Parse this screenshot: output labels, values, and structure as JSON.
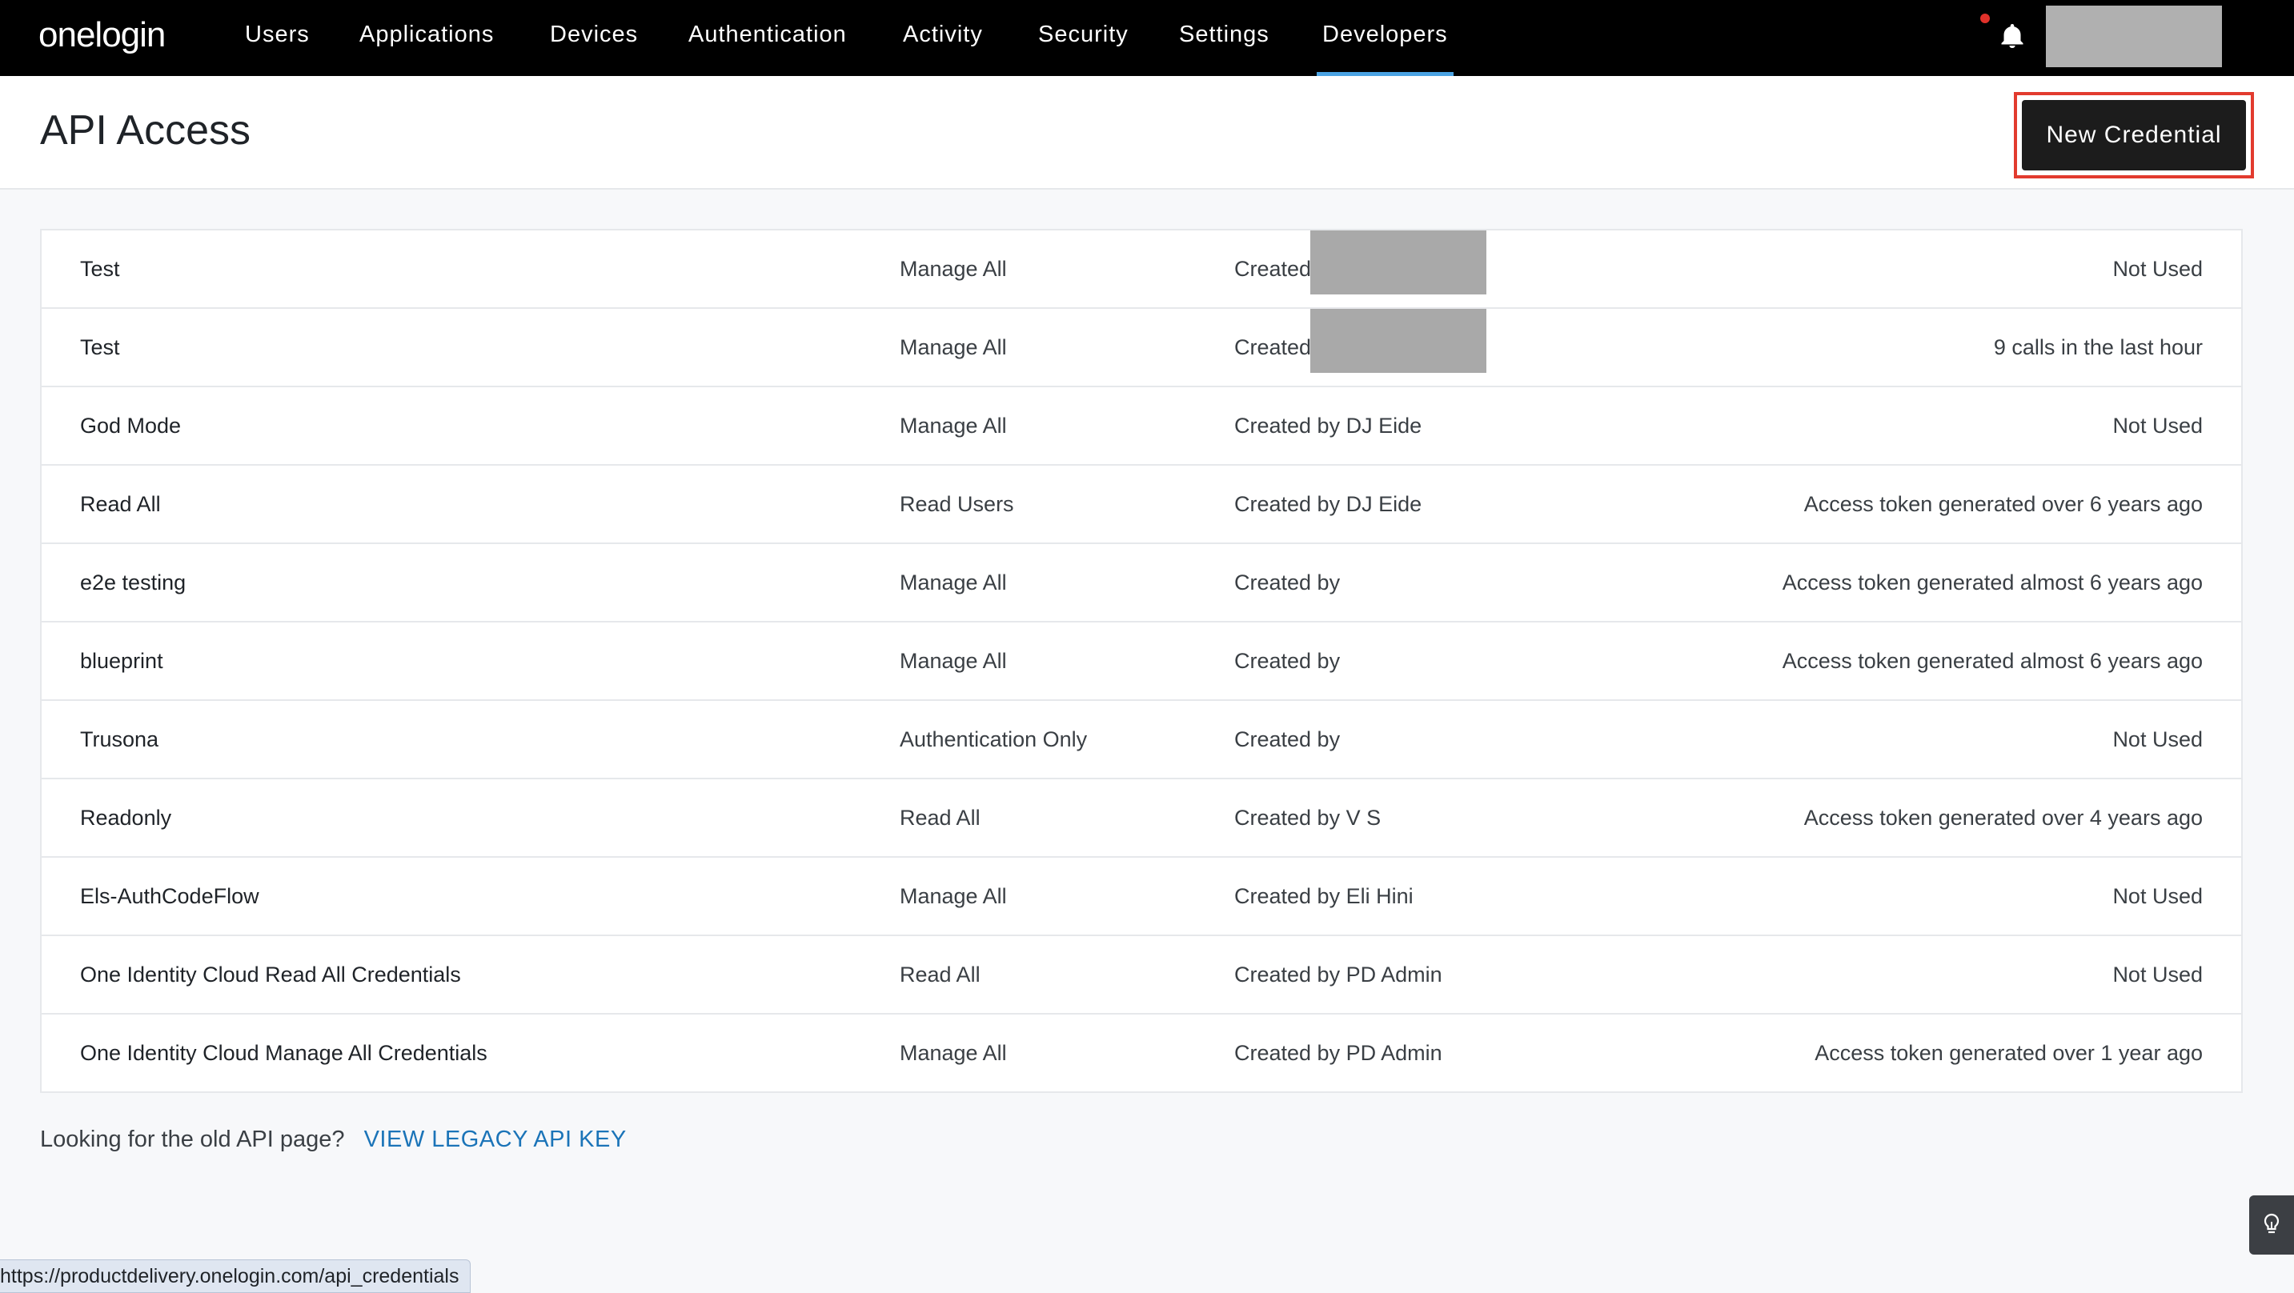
{
  "nav": {
    "logo": "onelogin",
    "items": [
      {
        "label": "Users"
      },
      {
        "label": "Applications"
      },
      {
        "label": "Devices"
      },
      {
        "label": "Authentication"
      },
      {
        "label": "Activity"
      },
      {
        "label": "Security"
      },
      {
        "label": "Settings"
      },
      {
        "label": "Developers",
        "active": true
      }
    ],
    "bell_icon": "bell-icon",
    "notification_color": "#e0312a"
  },
  "header": {
    "title": "API Access",
    "new_credential_label": "New Credential",
    "highlight_color": "#e23b2e"
  },
  "credentials": [
    {
      "name": "Test",
      "scope": "Manage All",
      "created": "Created",
      "usage": "Not Used",
      "redacted": true
    },
    {
      "name": "Test",
      "scope": "Manage All",
      "created": "Created",
      "usage": "9 calls in the last hour",
      "redacted": true
    },
    {
      "name": "God Mode",
      "scope": "Manage All",
      "created": "Created by DJ Eide",
      "usage": "Not Used"
    },
    {
      "name": "Read All",
      "scope": "Read Users",
      "created": "Created by DJ Eide",
      "usage": "Access token generated over 6 years ago"
    },
    {
      "name": "e2e testing",
      "scope": "Manage All",
      "created": "Created by",
      "usage": "Access token generated almost 6 years ago"
    },
    {
      "name": "blueprint",
      "scope": "Manage All",
      "created": "Created by",
      "usage": "Access token generated almost 6 years ago"
    },
    {
      "name": "Trusona",
      "scope": "Authentication Only",
      "created": "Created by",
      "usage": "Not Used"
    },
    {
      "name": "Readonly",
      "scope": "Read All",
      "created": "Created by V S",
      "usage": "Access token generated over 4 years ago"
    },
    {
      "name": "Els-AuthCodeFlow",
      "scope": "Manage All",
      "created": "Created by Eli Hini",
      "usage": "Not Used"
    },
    {
      "name": "One Identity Cloud Read All Credentials",
      "scope": "Read All",
      "created": "Created by PD Admin",
      "usage": "Not Used"
    },
    {
      "name": "One Identity Cloud Manage All Credentials",
      "scope": "Manage All",
      "created": "Created by PD Admin",
      "usage": "Access token generated over 1 year ago"
    }
  ],
  "legacy": {
    "prompt": "Looking for the old API page?",
    "link_label": "VIEW LEGACY API KEY"
  },
  "status_bar": {
    "url": "https://productdelivery.onelogin.com/api_credentials"
  },
  "help_tab": {
    "icon": "lightbulb-icon"
  }
}
